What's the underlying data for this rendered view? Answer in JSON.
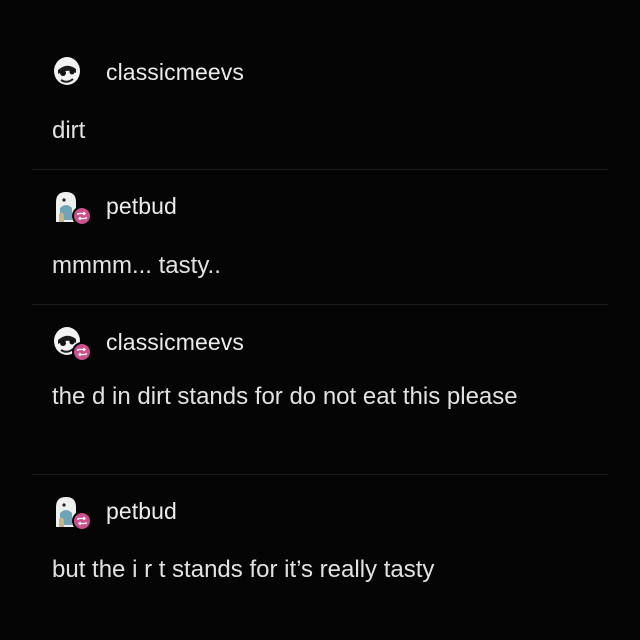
{
  "posts": [
    {
      "username": "classicmeevs",
      "body": "dirt",
      "avatar_icon": "skull-face-icon",
      "reblog": false
    },
    {
      "username": "petbud",
      "body": "mmmm... tasty..",
      "avatar_icon": "blue-creature-icon",
      "reblog": true
    },
    {
      "username": "classicmeevs",
      "body": "the d in dirt stands for do not eat this please",
      "avatar_icon": "skull-face-icon",
      "reblog": true
    },
    {
      "username": "petbud",
      "body": "but the i r t stands for it’s really tasty",
      "avatar_icon": "blue-creature-icon",
      "reblog": true
    }
  ],
  "colors": {
    "background": "#050505",
    "text": "#e2e2e2",
    "reblog_badge": "#c9508a",
    "divider": "#1c1c1c"
  },
  "icons": {
    "reblog": "reblog-icon"
  }
}
